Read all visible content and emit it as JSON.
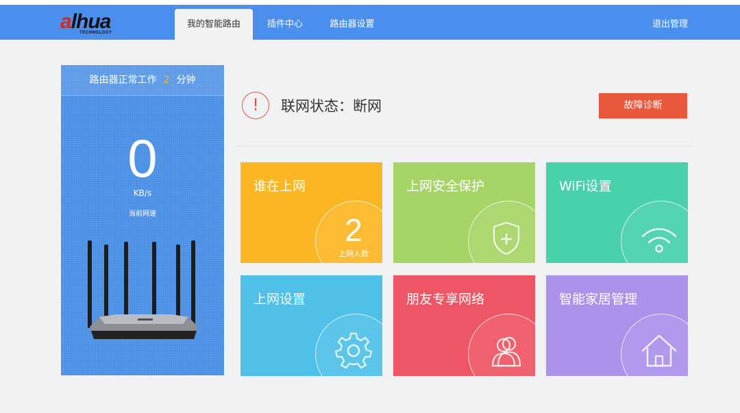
{
  "header": {
    "logo_main_prefix": "a",
    "logo_main_rest": "lhua",
    "logo_sub": "TECHNOLOGY",
    "tabs": [
      {
        "label": "我的智能路由",
        "active": true
      },
      {
        "label": "插件中心",
        "active": false
      },
      {
        "label": "路由器设置",
        "active": false
      }
    ],
    "logout_label": "退出管理",
    "accent_color": "#4a8fed"
  },
  "panel": {
    "uptime_prefix": "路由器正常工作",
    "uptime_value": "2",
    "uptime_unit": "分钟",
    "speed_value": "0",
    "speed_unit": "KB/s",
    "speed_label": "当前网速"
  },
  "status": {
    "icon": "!",
    "text": "联网状态：断网",
    "diagnose_label": "故障诊断",
    "alert_color": "#e9573d"
  },
  "tiles": [
    {
      "title": "谁在上网",
      "count": "2",
      "count_label": "上网人数",
      "color": "#fbb624",
      "icon": "users-count"
    },
    {
      "title": "上网安全保护",
      "color": "#a7d466",
      "icon": "shield-plus-icon"
    },
    {
      "title": "WiFi设置",
      "color": "#49d1ae",
      "icon": "wifi-icon"
    },
    {
      "title": "上网设置",
      "color": "#4fc1e9",
      "icon": "gear-icon"
    },
    {
      "title": "朋友专享网络",
      "color": "#ee5565",
      "icon": "friends-icon"
    },
    {
      "title": "智能家居管理",
      "color": "#ad92ec",
      "icon": "home-icon"
    }
  ]
}
